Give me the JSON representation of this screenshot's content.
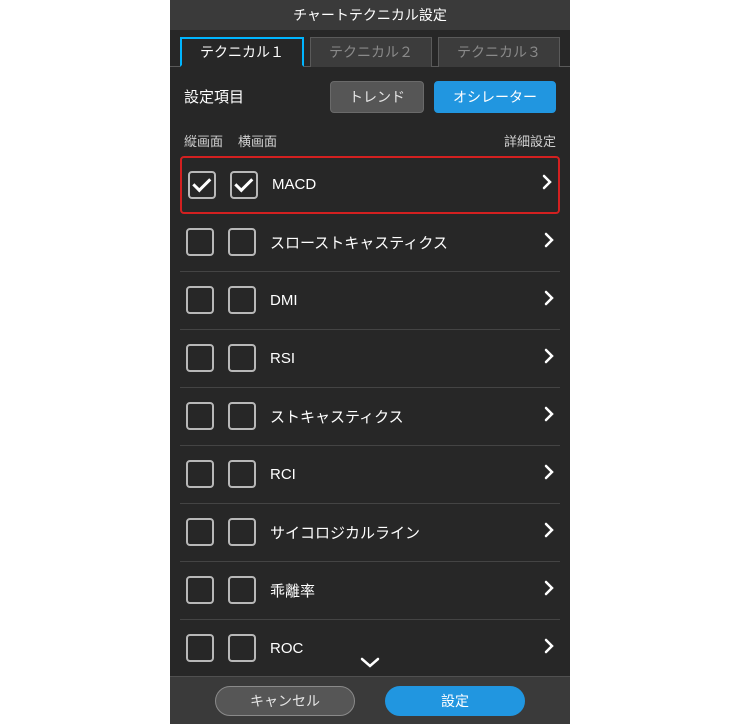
{
  "title": "チャートテクニカル設定",
  "tabs": [
    {
      "label": "テクニカル１",
      "active": true
    },
    {
      "label": "テクニカル２",
      "active": false
    },
    {
      "label": "テクニカル３",
      "active": false
    }
  ],
  "settings": {
    "label": "設定項目",
    "segments": [
      {
        "label": "トレンド",
        "active": false
      },
      {
        "label": "オシレーター",
        "active": true
      }
    ]
  },
  "listHeader": {
    "portrait": "縦画面",
    "landscape": "横画面",
    "detail": "詳細設定"
  },
  "items": [
    {
      "label": "MACD",
      "portrait": true,
      "landscape": true,
      "highlighted": true
    },
    {
      "label": "スローストキャスティクス",
      "portrait": false,
      "landscape": false,
      "highlighted": false
    },
    {
      "label": "DMI",
      "portrait": false,
      "landscape": false,
      "highlighted": false
    },
    {
      "label": "RSI",
      "portrait": false,
      "landscape": false,
      "highlighted": false
    },
    {
      "label": "ストキャスティクス",
      "portrait": false,
      "landscape": false,
      "highlighted": false
    },
    {
      "label": "RCI",
      "portrait": false,
      "landscape": false,
      "highlighted": false
    },
    {
      "label": "サイコロジカルライン",
      "portrait": false,
      "landscape": false,
      "highlighted": false
    },
    {
      "label": "乖離率",
      "portrait": false,
      "landscape": false,
      "highlighted": false
    },
    {
      "label": "ROC",
      "portrait": false,
      "landscape": false,
      "highlighted": false
    }
  ],
  "footer": {
    "cancel": "キャンセル",
    "confirm": "設定"
  }
}
